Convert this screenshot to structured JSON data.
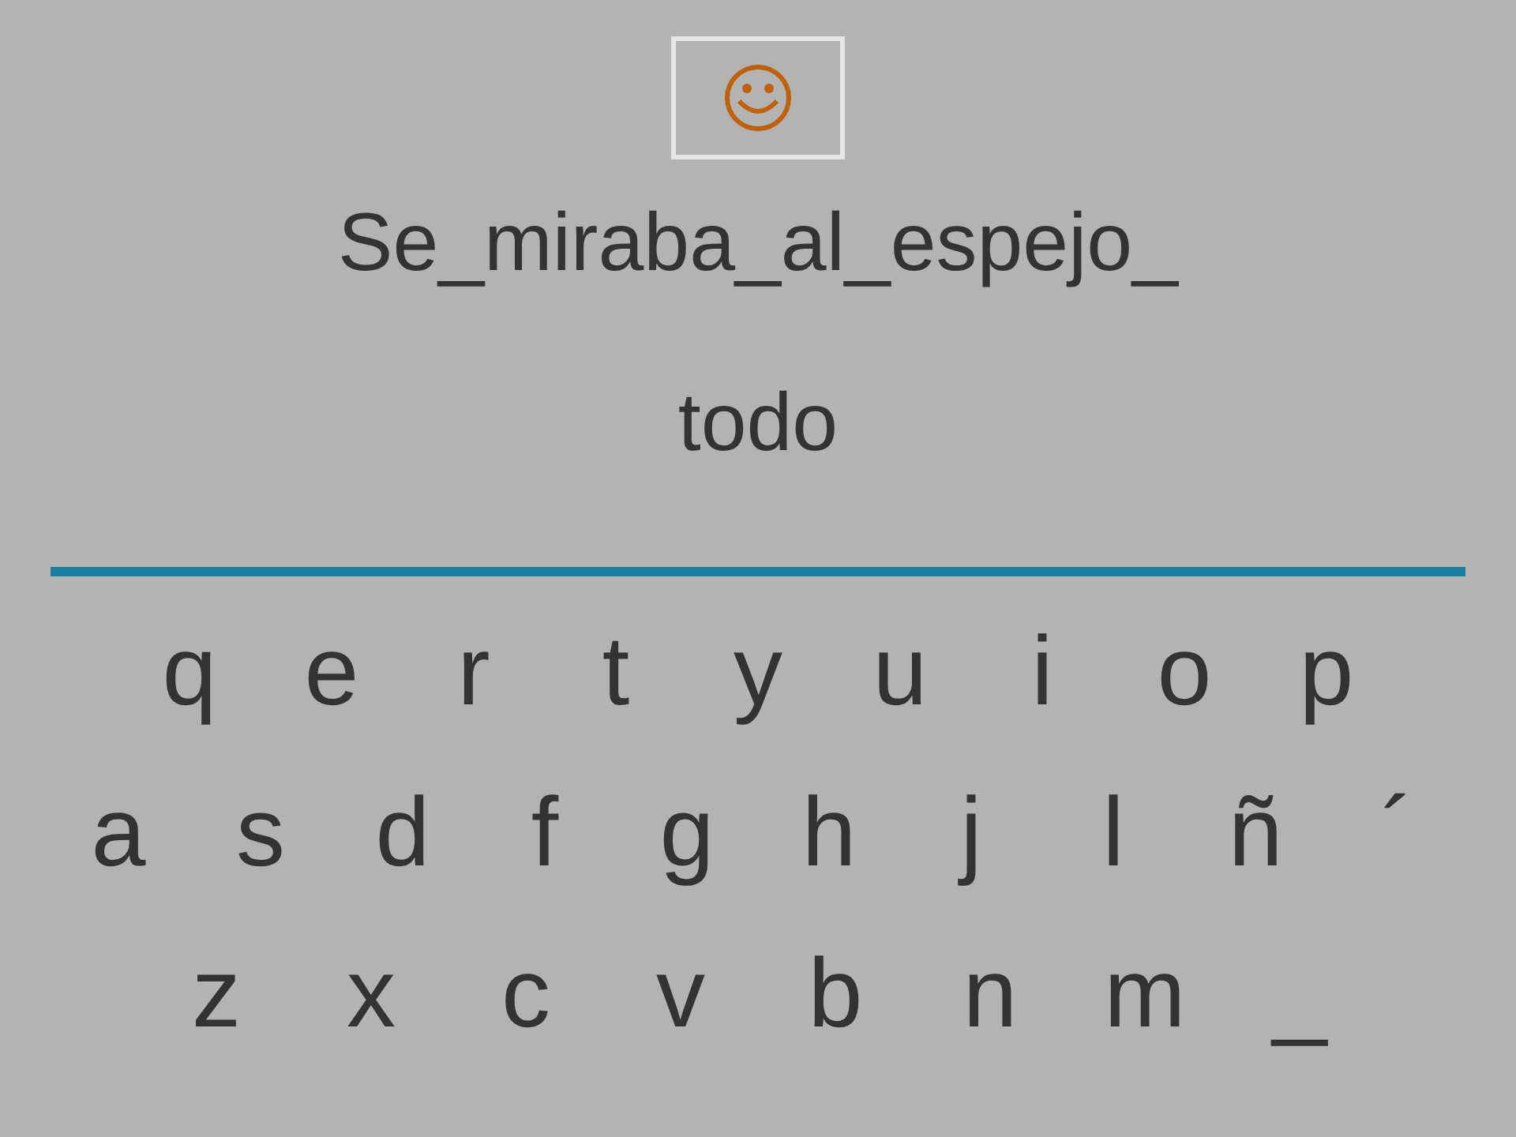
{
  "sentence": "Se_miraba_al_espejo_",
  "answer": "todo",
  "keyboard": [
    [
      "q",
      "e",
      "r",
      "t",
      "y",
      "u",
      "i",
      "o",
      "p"
    ],
    [
      "a",
      "s",
      "d",
      "f",
      "g",
      "h",
      "j",
      "l",
      "ñ",
      "´"
    ],
    [
      "z",
      "x",
      "c",
      "v",
      "b",
      "n",
      "m",
      "_"
    ]
  ]
}
